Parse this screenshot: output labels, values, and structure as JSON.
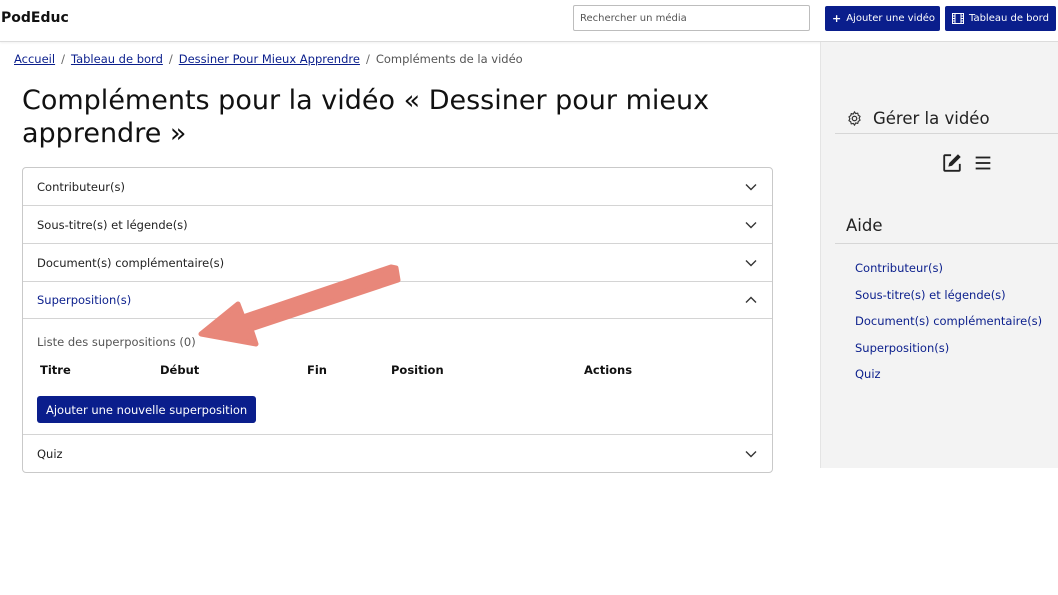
{
  "header": {
    "brand": "PodEduc",
    "search_placeholder": "Rechercher un média",
    "add_video_label": "Ajouter une vidéo",
    "dashboard_label": "Tableau de bord"
  },
  "breadcrumb": {
    "items": [
      "Accueil",
      "Tableau de bord",
      "Dessiner Pour Mieux Apprendre"
    ],
    "current": "Compléments de la vidéo",
    "separator": "/"
  },
  "page": {
    "title": "Compléments pour la vidéo « Dessiner pour mieux apprendre »"
  },
  "accordion": {
    "items": [
      {
        "label": "Contributeur(s)",
        "open": false
      },
      {
        "label": "Sous-titre(s) et légende(s)",
        "open": false
      },
      {
        "label": "Document(s) complémentaire(s)",
        "open": false
      },
      {
        "label": "Superposition(s)",
        "open": true
      },
      {
        "label": "Quiz",
        "open": false
      }
    ],
    "overlay": {
      "list_title": "Liste des superpositions (0)",
      "columns": [
        "Titre",
        "Début",
        "Fin",
        "Position",
        "Actions"
      ],
      "add_button": "Ajouter une nouvelle superposition"
    }
  },
  "sidebar": {
    "manage_title": "Gérer la vidéo",
    "help_title": "Aide",
    "help_links": [
      "Contributeur(s)",
      "Sous-titre(s) et légende(s)",
      "Document(s) complémentaire(s)",
      "Superposition(s)",
      "Quiz"
    ]
  },
  "colors": {
    "primary": "#0a1e8c",
    "arrow": "#e8877a",
    "sidebar_bg": "#f3f3f3"
  }
}
